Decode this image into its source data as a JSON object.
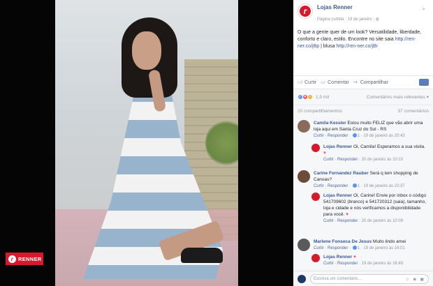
{
  "photo_badge": {
    "brand": "RENNER"
  },
  "post": {
    "page_name": "Lojas Renner",
    "meta_prefix": "Página curtida",
    "date": "19 de janeiro",
    "text": "O que a gente quer de um look? Versatilidade, liberdade, conforto e claro, estilo. Encontre no site saia ",
    "link1": "http://ren-ner.co/jBp",
    "separator": " | blusa ",
    "link2": "http://ren-ner.co/jBr"
  },
  "actions": {
    "like": "Curtir",
    "comment": "Comentar",
    "share": "Compartilhar"
  },
  "reactions": {
    "count": "1,5 mil",
    "sort": "Comentários mais relevantes"
  },
  "stats": {
    "shares": "20 compartilhamentos",
    "comments": "37 comentários"
  },
  "comments": [
    {
      "name": "Camila Kessler",
      "text": "Estou muito FELIZ que vão abrir uma loja aqui em Santa Cruz do Sul - RS",
      "actions": "Curtir · Responder",
      "likes": "1",
      "time": "19 de janeiro às 20:43",
      "reply": {
        "name": "Lojas Renner",
        "text": "Oi, Camila! Esperamos a sua visita.",
        "actions": "Curtir · Responder",
        "time": "20 de janeiro às 10:10"
      }
    },
    {
      "name": "Carine Fernandez Rauber",
      "text": "Será q tem shopping de Canoas?",
      "actions": "Curtir · Responder",
      "likes": "1",
      "time": "19 de janeiro às 22:37",
      "reply": {
        "name": "Lojas Renner",
        "text": "Oi, Carine! Envie por inbox o código 541709602 (branco) e 541720312 (saia), tamanho, loja e cidade e nós verificamos a disponibilidade para você.",
        "actions": "Curtir · Responder",
        "time": "20 de janeiro às 10:09"
      }
    },
    {
      "name": "Marlene Fonseca De Jesus",
      "text": "Muito lindo amei",
      "actions": "Curtir · Responder",
      "likes": "1",
      "time": "19 de janeiro às 16:01",
      "reply": {
        "name": "Lojas Renner",
        "text": "",
        "actions": "Curtir · Responder",
        "time": "19 de janeiro às 16:49"
      }
    }
  ],
  "composer": {
    "placeholder": "Escreva um comentário..."
  }
}
